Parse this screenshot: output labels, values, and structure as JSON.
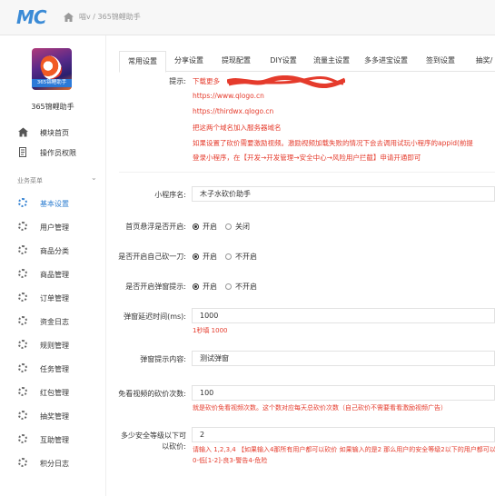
{
  "header": {
    "logo_text": "MC",
    "breadcrumb": "喵v / 365锦鲤助手"
  },
  "sidebar": {
    "app_logo_banner": "365锦鲤助手",
    "app_name": "365锦鲤助手",
    "top_items": [
      {
        "label": "模块首页",
        "icon": "home-icon"
      },
      {
        "label": "操作员权限",
        "icon": "document-icon"
      }
    ],
    "section_title": "业务菜单",
    "items": [
      {
        "label": "基本设置"
      },
      {
        "label": "用户管理"
      },
      {
        "label": "商品分类"
      },
      {
        "label": "商品管理"
      },
      {
        "label": "订单管理"
      },
      {
        "label": "资金日志"
      },
      {
        "label": "规则管理"
      },
      {
        "label": "任务管理"
      },
      {
        "label": "红包管理"
      },
      {
        "label": "抽奖管理"
      },
      {
        "label": "互助管理"
      },
      {
        "label": "积分日志"
      }
    ],
    "active_index": 0
  },
  "tabs": [
    "常用设置",
    "分享设置",
    "提现配置",
    "DIY设置",
    "流量主设置",
    "多多进宝设置",
    "签到设置",
    "抽奖/"
  ],
  "active_tab": 0,
  "tips": {
    "label": "提示:",
    "lines": [
      "下载更多",
      "https://www.qlogo.cn",
      "https://thirdwx.qlogo.cn",
      "把这两个域名加入服务器域名",
      "如果设置了砍价需要激励视频。激励视频加载失败的情况下会去调用试玩小程序的appid(前提",
      "登录小程序，在【开发→开发管理→安全中心→风险用户拦截】申请开通即可"
    ]
  },
  "form": {
    "mini_name": {
      "label": "小程序名:",
      "value": "木子水砍价助手"
    },
    "home_enable": {
      "label": "首页悬浮是否开启:",
      "options": [
        "开启",
        "关闭"
      ],
      "selected": 0
    },
    "self_cut": {
      "label": "是否开启自己砍一刀:",
      "options": [
        "开启",
        "不开启"
      ],
      "selected": 0
    },
    "popup_tip": {
      "label": "是否开启弹窗提示:",
      "options": [
        "开启",
        "不开启"
      ],
      "selected": 0
    },
    "popup_delay": {
      "label": "弹窗延迟时间(ms):",
      "value": "1000",
      "hint": "1秒填 1000"
    },
    "popup_text": {
      "label": "弹窗提示内容:",
      "value": "测试弹窗"
    },
    "free_video": {
      "label": "免看视频的砍价次数:",
      "value": "100",
      "hint": "就是砍价免看视频次数。这个数对应每天总砍价次数（自己砍价不需要看看激励视频广告）"
    },
    "security_level": {
      "label_line1": "多少安全等级以下可",
      "label_line2": "以砍价:",
      "value": "2",
      "hint1": "请输入 1,2,3,4 【如果输入4那所有用户都可以砍价 如果输入的是2 那么用户的安全等级2以下的用户都可以砍价",
      "hint2": "0-低[1-2]-良3-警告4-危险"
    }
  }
}
